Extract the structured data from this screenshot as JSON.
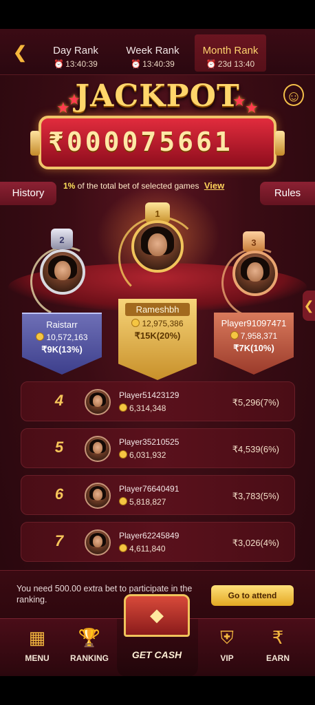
{
  "header": {
    "tabs": [
      {
        "label": "Day Rank",
        "time": "13:40:39"
      },
      {
        "label": "Week Rank",
        "time": "13:40:39"
      },
      {
        "label": "Month Rank",
        "time": "23d 13:40"
      }
    ],
    "active_tab": "Month Rank"
  },
  "jackpot": {
    "title": "JACKPOT",
    "amount": "₹000075661"
  },
  "info": {
    "history_label": "History",
    "rules_label": "Rules",
    "percent": "1%",
    "text": " of the total bet of selected games",
    "view_label": "View"
  },
  "podium": {
    "first": {
      "rank": "1",
      "name": "Rameshbh",
      "score": "12,975,386",
      "prize": "₹15K(20%)"
    },
    "second": {
      "rank": "2",
      "name": "Raistarr",
      "score": "10,572,163",
      "prize": "₹9K(13%)"
    },
    "third": {
      "rank": "3",
      "name": "Player91097471",
      "score": "7,958,371",
      "prize": "₹7K(10%)"
    }
  },
  "ranks": [
    {
      "rank": "4",
      "name": "Player51423129",
      "score": "6,314,348",
      "prize": "₹5,296(7%)"
    },
    {
      "rank": "5",
      "name": "Player35210525",
      "score": "6,031,932",
      "prize": "₹4,539(6%)"
    },
    {
      "rank": "6",
      "name": "Player76640491",
      "score": "5,818,827",
      "prize": "₹3,783(5%)"
    },
    {
      "rank": "7",
      "name": "Player62245849",
      "score": "4,611,840",
      "prize": "₹3,026(4%)"
    }
  ],
  "notice": {
    "text": "You need 500.00 extra bet to participate in the ranking.",
    "button_label": "Go to attend"
  },
  "nav": {
    "menu": "MENU",
    "ranking": "RANKING",
    "get_cash": "GET CASH",
    "vip": "VIP",
    "earn": "EARN"
  },
  "icons": [
    "back-arrow-icon",
    "alarm-clock-icon",
    "user-gift-icon",
    "crown-icon",
    "coin-icon",
    "chevron-left-icon",
    "grid-menu-icon",
    "trophy-icon",
    "treasure-chest-icon",
    "vip-shield-icon",
    "rupee-coin-icon"
  ],
  "colors": {
    "accent": "#f6c55a",
    "background": "#3a0c14",
    "button": "#e3a823"
  }
}
